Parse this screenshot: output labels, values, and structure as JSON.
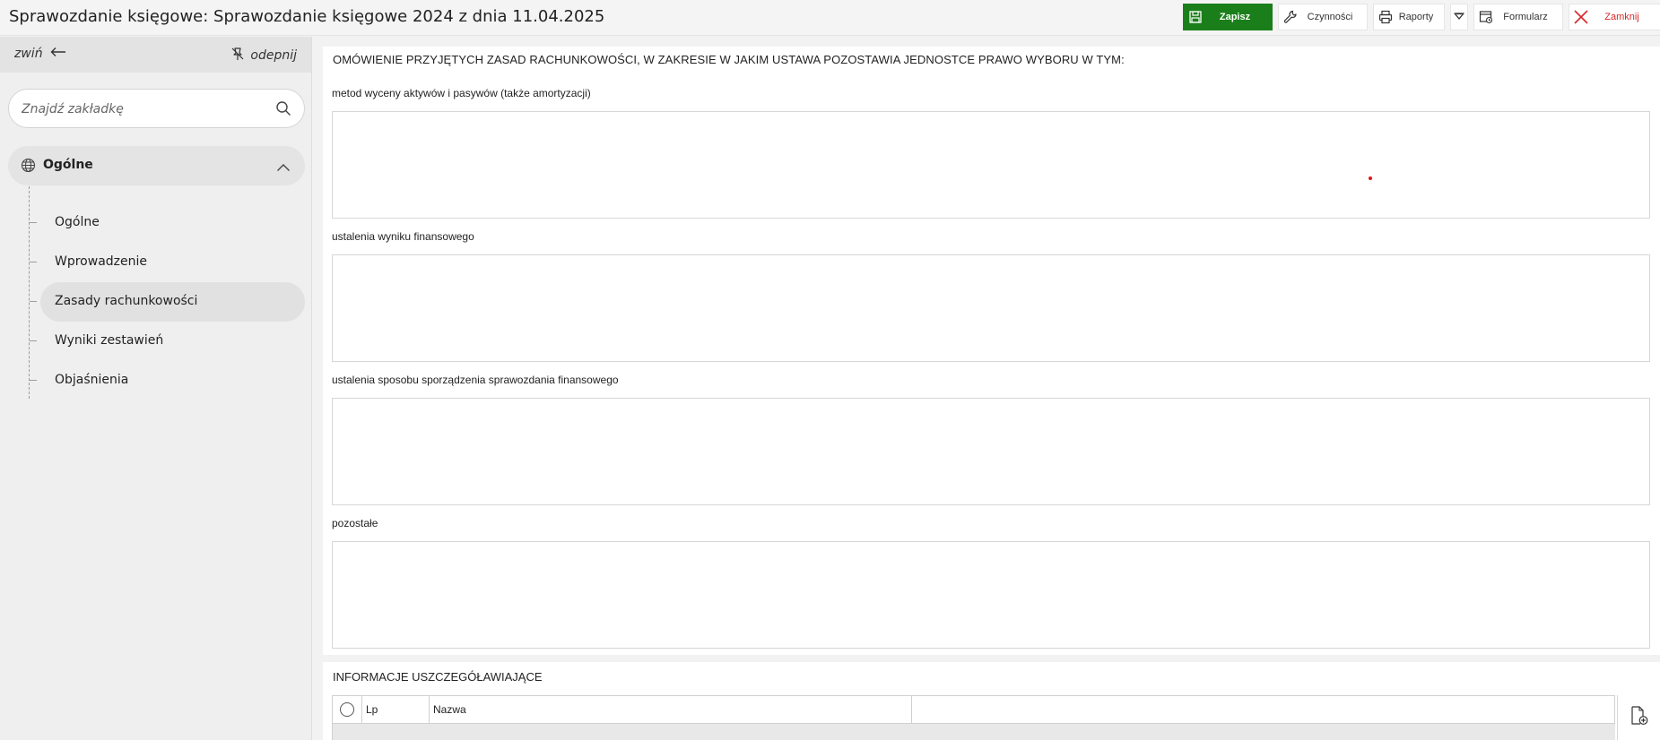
{
  "header": {
    "title": "Sprawozdanie księgowe: Sprawozdanie księgowe 2024 z dnia 11.04.2025"
  },
  "toolbar": {
    "save_label": "Zapisz",
    "actions_label": "Czynności",
    "reports_label": "Raporty",
    "form_label": "Formularz",
    "close_label": "Zamknij"
  },
  "sidebar": {
    "collapse_label": "zwiń",
    "unpin_label": "odepnij",
    "search_placeholder": "Znajdź zakładkę",
    "group_label": "Ogólne",
    "items": [
      {
        "label": "Ogólne",
        "active": false
      },
      {
        "label": "Wprowadzenie",
        "active": false
      },
      {
        "label": "Zasady rachunkowości",
        "active": true
      },
      {
        "label": "Wyniki zestawień",
        "active": false
      },
      {
        "label": "Objaśnienia",
        "active": false
      }
    ]
  },
  "main": {
    "section_title": "OMÓWIENIE PRZYJĘTYCH ZASAD RACHUNKOWOŚCI, W ZAKRESIE W JAKIM USTAWA POZOSTAWIA JEDNOSTCE PRAWO WYBORU W TYM:",
    "fields": [
      {
        "label": "metod wyceny aktywów i pasywów (także amortyzacji)",
        "value": ""
      },
      {
        "label": "ustalenia wyniku finansowego",
        "value": ""
      },
      {
        "label": "ustalenia sposobu sporządzenia sprawozdania finansowego",
        "value": ""
      },
      {
        "label": "pozostałe",
        "value": ""
      }
    ],
    "details_title": "INFORMACJE USZCZEGÓŁAWIAJĄCE",
    "table": {
      "columns": [
        "Lp",
        "Nazwa"
      ]
    }
  },
  "colors": {
    "save_green": "#1a7f1a",
    "close_red": "#d62828",
    "marker_red": "#e01515"
  },
  "icons": [
    "save-icon",
    "wrench-icon",
    "printer-icon",
    "triangle-down-icon",
    "form-icon",
    "close-icon",
    "arrow-left-icon",
    "unpin-icon",
    "search-icon",
    "globe-icon",
    "chevron-up-icon",
    "add-document-icon"
  ]
}
